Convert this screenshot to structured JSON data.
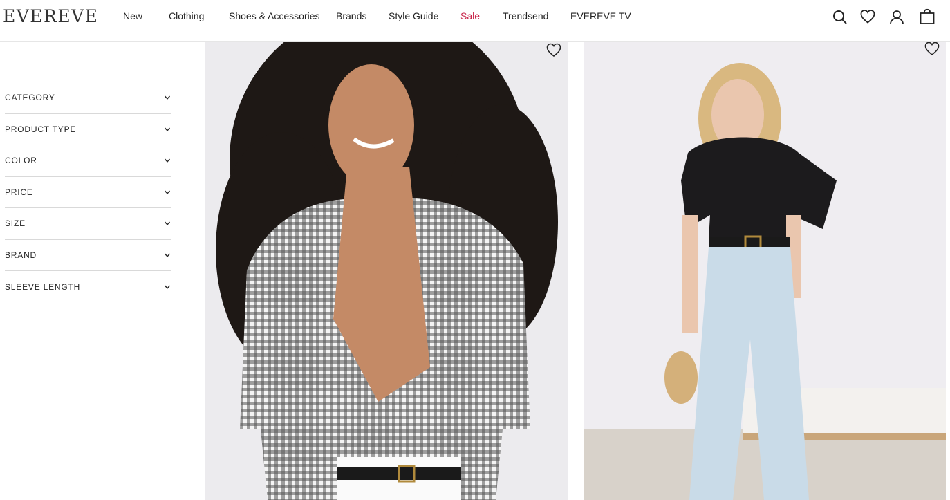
{
  "header": {
    "logo": "EVEREVE",
    "nav": [
      {
        "label": "New"
      },
      {
        "label": "Clothing"
      },
      {
        "label": "Shoes & Accessories"
      },
      {
        "label": "Brands"
      },
      {
        "label": "Style Guide"
      },
      {
        "label": "Sale"
      },
      {
        "label": "Trendsend"
      },
      {
        "label": "EVEREVE TV"
      }
    ],
    "icons": [
      "search-icon",
      "heart-icon",
      "account-icon",
      "cart-icon"
    ]
  },
  "filters": [
    {
      "label": "CATEGORY"
    },
    {
      "label": "PRODUCT TYPE"
    },
    {
      "label": "COLOR"
    },
    {
      "label": "PRICE"
    },
    {
      "label": "SIZE"
    },
    {
      "label": "BRAND"
    },
    {
      "label": "SLEEVE LENGTH"
    }
  ],
  "colors": {
    "sale": "#c8254a",
    "text": "#222222",
    "divider": "#d9d9d9"
  }
}
